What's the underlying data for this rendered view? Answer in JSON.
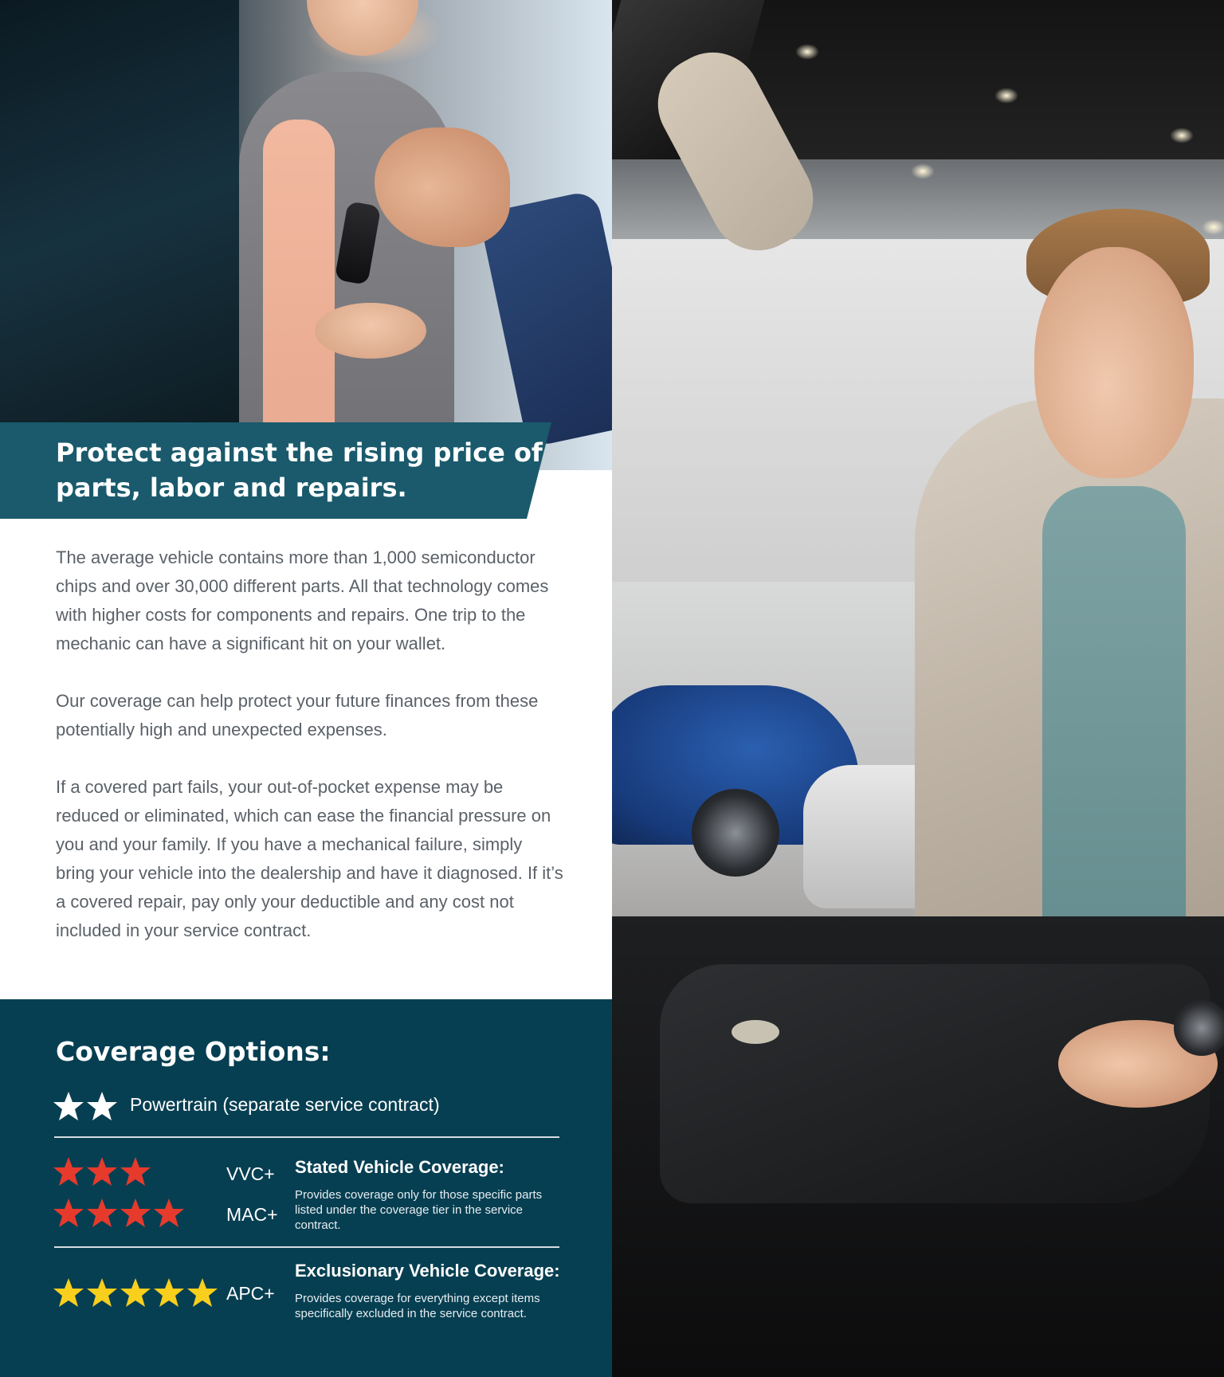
{
  "banner": {
    "title": "Protect against the rising price of parts, labor and repairs."
  },
  "body": {
    "paragraphs": [
      "The average vehicle contains more than 1,000 semiconductor chips and over 30,000 different parts. All that technology comes with higher costs for components and repairs. One trip to the mechanic can have a significant hit on your wallet.",
      "Our coverage can help protect your future finances from these potentially high and unexpected expenses.",
      "If a covered part fails, your out-of-pocket expense may be reduced or eliminated, which can ease the financial pressure on you and your family. If you have a mechanical failure, simply bring your vehicle into the dealership and have it diagnosed. If it’s a covered repair, pay only your deductible and any cost not included in your service contract."
    ]
  },
  "coverage": {
    "heading": "Coverage Options:",
    "powertrain": {
      "label": "Powertrain (separate service contract)",
      "stars": 2,
      "star_color": "#ffffff"
    },
    "stated": {
      "tiers": [
        {
          "code": "VVC+",
          "stars": 3
        },
        {
          "code": "MAC+",
          "stars": 4
        }
      ],
      "star_color": "#e53a2c",
      "title": "Stated Vehicle Coverage:",
      "description": "Provides coverage only for those specific parts listed under the coverage tier in the service contract."
    },
    "exclusionary": {
      "tiers": [
        {
          "code": "APC+",
          "stars": 5
        }
      ],
      "star_color": "#f7cf1c",
      "title": "Exclusionary Vehicle Coverage:",
      "description": "Provides coverage for everything except items specifically excluded in the service contract."
    }
  },
  "colors": {
    "banner": "#1a5a6c",
    "panel": "#073f52",
    "body_text": "#5b6168"
  },
  "images": {
    "top_left": "photo-key-handover",
    "right": "photo-man-inspecting-engine"
  }
}
